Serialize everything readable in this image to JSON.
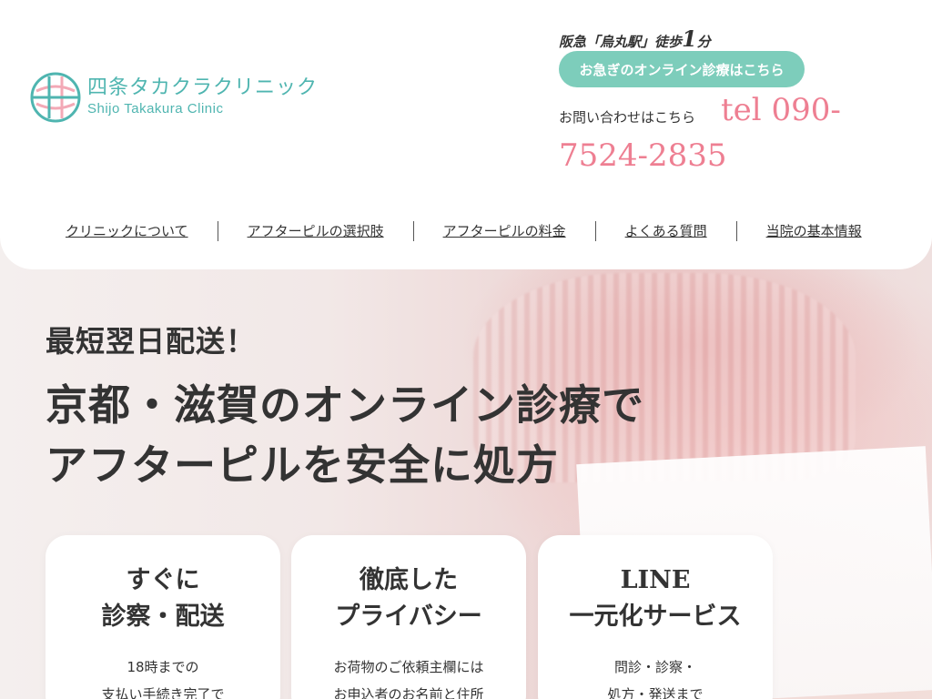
{
  "colors": {
    "accent_teal": "#7dcdbb",
    "logo_teal": "#4fb5b0",
    "tel_pink": "#ee7f92",
    "text_dark": "#333333"
  },
  "logo": {
    "icon": "clinic-globe-logo-icon",
    "name_jp": "四条タカクラクリニック",
    "name_en": "Shijo Takakura Clinic"
  },
  "header": {
    "access_prefix": "阪急「烏丸駅」徒歩",
    "access_minutes": "1",
    "access_unit": "分",
    "online_button": "お急ぎのオンライン診療はこちら",
    "contact_label": "お問い合わせはこちら",
    "tel_line1": "tel 090-",
    "tel_line2": "7524-2835"
  },
  "nav": {
    "items": [
      {
        "label": "クリニックについて"
      },
      {
        "label": "アフターピルの選択肢"
      },
      {
        "label": "アフターピルの料金"
      },
      {
        "label": "よくある質問"
      },
      {
        "label": "当院の基本情報"
      }
    ]
  },
  "hero": {
    "lead": "最短翌日配送！",
    "headline_line1": "京都・滋賀のオンライン診療で",
    "headline_line2": "アフターピルを安全に処方"
  },
  "features": [
    {
      "title_line1": "すぐに",
      "title_line2": "診察・配送",
      "body_line1": "18時までの",
      "body_line2": "支払い手続き完了で"
    },
    {
      "title_line1": "徹底した",
      "title_line2": "プライバシー",
      "body_line1": "お荷物のご依頼主欄には",
      "body_line2": "お申込者のお名前と住所"
    },
    {
      "title_line1": "LINE",
      "title_line2": "一元化サービス",
      "body_line1": "問診・診察・",
      "body_line2": "処方・発送まで"
    }
  ]
}
